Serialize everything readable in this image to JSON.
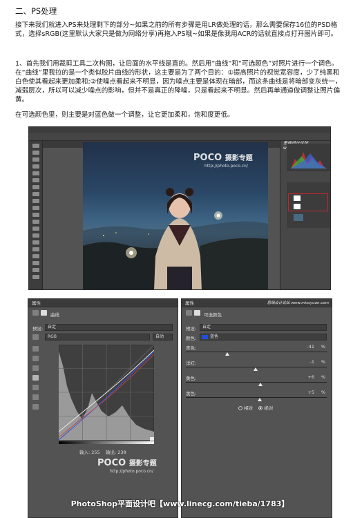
{
  "article": {
    "heading": "二、PS处理",
    "para1": "接下来我们就进入PS来处理剩下的部分~如果之前的所有步骤是用LR做处理的话，那么需要保存16位的PSD格式，选择sRGB(这里默认大家只是做为网络分享)再拖入PS哦~如果是像我用ACR的话就直接点打开图片即可。",
    "para2": "1、首先我们用裁剪工具二次构图，让后面的水平线是直的。然后用“曲线”和“可选颜色”对照片进行一个调色。在“曲线”里我拉的是一个类似胶片曲线的形状，这主要是为了两个目的：①提高照片的视觉宽容度，少了纯黑和白色使其看起来更加柔和;②使噪点看起来不明显，因为噪点主要是体现在暗部，而这条曲线是将暗部变灰统一，减弱层次，所以可以减少噪点的影响，但并不是真正的降噪，只是看起来不明显。然后再单通道做调整让照片偏黄。",
    "para3": "在可选颜色里，则主要是对蓝色做一个调整，让它更加柔和，饱和度更低。"
  },
  "watermarks": {
    "poco_brand": "POCO",
    "poco_cn": "摄影专题",
    "poco_url": "http://photo.poco.cn/",
    "site_tag": "思缘设计论坛",
    "site_url": "www.missyuan.com"
  },
  "curves_panel": {
    "tab_label": "属性",
    "title": "曲线",
    "preset_label": "预设:",
    "preset_value": "自定",
    "channel_value": "RGB",
    "auto_button": "自动",
    "input_label": "输入:",
    "input_value": "255",
    "output_label": "输出:",
    "output_value": "238"
  },
  "selective_color_panel": {
    "tab_label": "属性",
    "title": "可选颜色",
    "preset_label": "预设:",
    "preset_value": "自定",
    "colors_label": "颜色:",
    "colors_value": "蓝色",
    "sliders": [
      {
        "label": "青色:",
        "value": "-41",
        "unit": "%",
        "level": -41
      },
      {
        "label": "洋红:",
        "value": "-1",
        "unit": "%",
        "level": -1
      },
      {
        "label": "黄色:",
        "value": "+6",
        "unit": "%",
        "level": 6
      },
      {
        "label": "黑色:",
        "value": "+5",
        "unit": "%",
        "level": 5
      }
    ],
    "relative_label": "相对",
    "absolute_label": "绝对",
    "selected_method": "absolute"
  },
  "footer_banner": "PhotoShop平面设计吧【www.linecg.com/tieba/1783】",
  "colors": {
    "panel_bg": "#535353",
    "blue_swatch": "#1f4fd8",
    "layer_highlight": "#c0282d"
  }
}
